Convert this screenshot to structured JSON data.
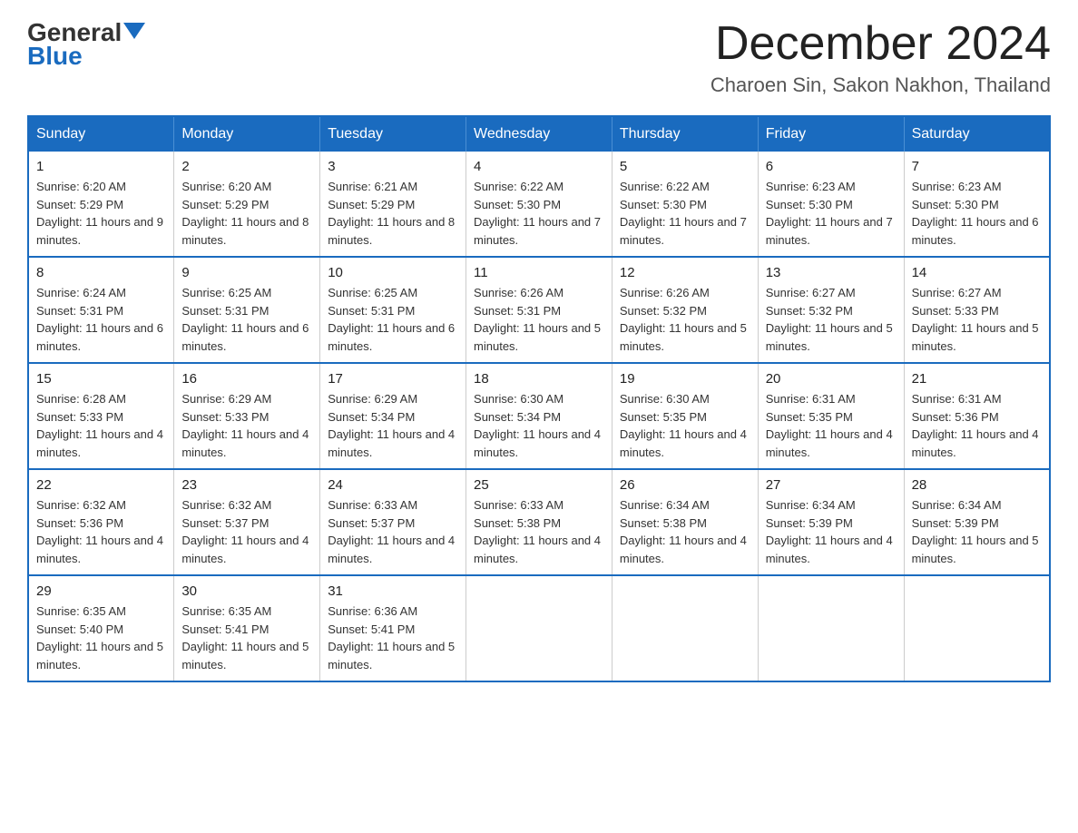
{
  "logo": {
    "general": "General",
    "blue": "Blue"
  },
  "header": {
    "month_title": "December 2024",
    "location": "Charoen Sin, Sakon Nakhon, Thailand"
  },
  "weekdays": [
    "Sunday",
    "Monday",
    "Tuesday",
    "Wednesday",
    "Thursday",
    "Friday",
    "Saturday"
  ],
  "weeks": [
    [
      {
        "day": "1",
        "sunrise": "6:20 AM",
        "sunset": "5:29 PM",
        "daylight": "11 hours and 9 minutes."
      },
      {
        "day": "2",
        "sunrise": "6:20 AM",
        "sunset": "5:29 PM",
        "daylight": "11 hours and 8 minutes."
      },
      {
        "day": "3",
        "sunrise": "6:21 AM",
        "sunset": "5:29 PM",
        "daylight": "11 hours and 8 minutes."
      },
      {
        "day": "4",
        "sunrise": "6:22 AM",
        "sunset": "5:30 PM",
        "daylight": "11 hours and 7 minutes."
      },
      {
        "day": "5",
        "sunrise": "6:22 AM",
        "sunset": "5:30 PM",
        "daylight": "11 hours and 7 minutes."
      },
      {
        "day": "6",
        "sunrise": "6:23 AM",
        "sunset": "5:30 PM",
        "daylight": "11 hours and 7 minutes."
      },
      {
        "day": "7",
        "sunrise": "6:23 AM",
        "sunset": "5:30 PM",
        "daylight": "11 hours and 6 minutes."
      }
    ],
    [
      {
        "day": "8",
        "sunrise": "6:24 AM",
        "sunset": "5:31 PM",
        "daylight": "11 hours and 6 minutes."
      },
      {
        "day": "9",
        "sunrise": "6:25 AM",
        "sunset": "5:31 PM",
        "daylight": "11 hours and 6 minutes."
      },
      {
        "day": "10",
        "sunrise": "6:25 AM",
        "sunset": "5:31 PM",
        "daylight": "11 hours and 6 minutes."
      },
      {
        "day": "11",
        "sunrise": "6:26 AM",
        "sunset": "5:31 PM",
        "daylight": "11 hours and 5 minutes."
      },
      {
        "day": "12",
        "sunrise": "6:26 AM",
        "sunset": "5:32 PM",
        "daylight": "11 hours and 5 minutes."
      },
      {
        "day": "13",
        "sunrise": "6:27 AM",
        "sunset": "5:32 PM",
        "daylight": "11 hours and 5 minutes."
      },
      {
        "day": "14",
        "sunrise": "6:27 AM",
        "sunset": "5:33 PM",
        "daylight": "11 hours and 5 minutes."
      }
    ],
    [
      {
        "day": "15",
        "sunrise": "6:28 AM",
        "sunset": "5:33 PM",
        "daylight": "11 hours and 4 minutes."
      },
      {
        "day": "16",
        "sunrise": "6:29 AM",
        "sunset": "5:33 PM",
        "daylight": "11 hours and 4 minutes."
      },
      {
        "day": "17",
        "sunrise": "6:29 AM",
        "sunset": "5:34 PM",
        "daylight": "11 hours and 4 minutes."
      },
      {
        "day": "18",
        "sunrise": "6:30 AM",
        "sunset": "5:34 PM",
        "daylight": "11 hours and 4 minutes."
      },
      {
        "day": "19",
        "sunrise": "6:30 AM",
        "sunset": "5:35 PM",
        "daylight": "11 hours and 4 minutes."
      },
      {
        "day": "20",
        "sunrise": "6:31 AM",
        "sunset": "5:35 PM",
        "daylight": "11 hours and 4 minutes."
      },
      {
        "day": "21",
        "sunrise": "6:31 AM",
        "sunset": "5:36 PM",
        "daylight": "11 hours and 4 minutes."
      }
    ],
    [
      {
        "day": "22",
        "sunrise": "6:32 AM",
        "sunset": "5:36 PM",
        "daylight": "11 hours and 4 minutes."
      },
      {
        "day": "23",
        "sunrise": "6:32 AM",
        "sunset": "5:37 PM",
        "daylight": "11 hours and 4 minutes."
      },
      {
        "day": "24",
        "sunrise": "6:33 AM",
        "sunset": "5:37 PM",
        "daylight": "11 hours and 4 minutes."
      },
      {
        "day": "25",
        "sunrise": "6:33 AM",
        "sunset": "5:38 PM",
        "daylight": "11 hours and 4 minutes."
      },
      {
        "day": "26",
        "sunrise": "6:34 AM",
        "sunset": "5:38 PM",
        "daylight": "11 hours and 4 minutes."
      },
      {
        "day": "27",
        "sunrise": "6:34 AM",
        "sunset": "5:39 PM",
        "daylight": "11 hours and 4 minutes."
      },
      {
        "day": "28",
        "sunrise": "6:34 AM",
        "sunset": "5:39 PM",
        "daylight": "11 hours and 5 minutes."
      }
    ],
    [
      {
        "day": "29",
        "sunrise": "6:35 AM",
        "sunset": "5:40 PM",
        "daylight": "11 hours and 5 minutes."
      },
      {
        "day": "30",
        "sunrise": "6:35 AM",
        "sunset": "5:41 PM",
        "daylight": "11 hours and 5 minutes."
      },
      {
        "day": "31",
        "sunrise": "6:36 AM",
        "sunset": "5:41 PM",
        "daylight": "11 hours and 5 minutes."
      },
      null,
      null,
      null,
      null
    ]
  ]
}
